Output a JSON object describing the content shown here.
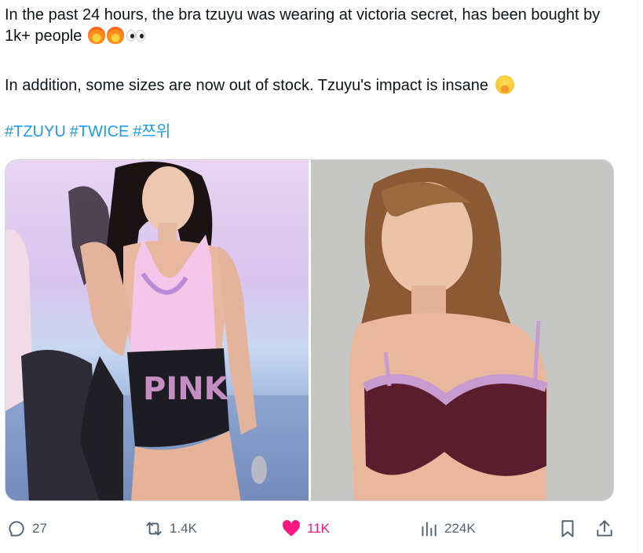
{
  "tweet": {
    "line1": "In the past 24 hours, the bra tzuyu was wearing at victoria secret, has been bought by 1k+ people",
    "line2": "In addition, some sizes are now out of stock. Tzuyu's impact is insane",
    "hashtags": [
      "#TZUYU",
      "#TWICE",
      "#쯔위"
    ]
  },
  "media": {
    "left_icon": "stage-photo-image",
    "right_icon": "product-photo-image"
  },
  "actions": {
    "replies": "27",
    "reposts": "1.4K",
    "likes": "11K",
    "views": "224K"
  },
  "colors": {
    "link": "#1d9bf0",
    "like": "#f91880",
    "muted": "#536471"
  }
}
